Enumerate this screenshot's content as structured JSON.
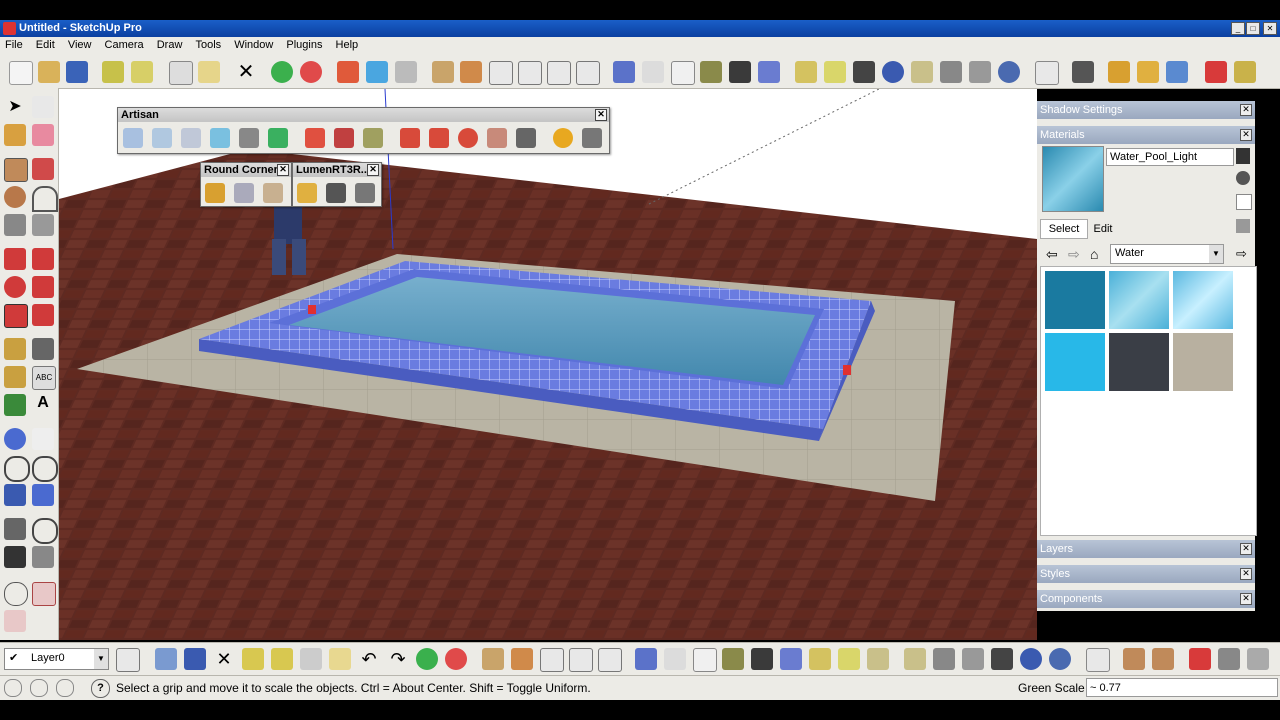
{
  "window": {
    "title": "Untitled - SketchUp Pro"
  },
  "menu": [
    "File",
    "Edit",
    "View",
    "Camera",
    "Draw",
    "Tools",
    "Window",
    "Plugins",
    "Help"
  ],
  "floating_toolbars": {
    "artisan": {
      "title": "Artisan"
    },
    "round_corner": {
      "title": "Round Corner"
    },
    "lumen": {
      "title": "LumenRT3R..."
    }
  },
  "tray": {
    "shadow_settings": "Shadow Settings",
    "materials": {
      "title": "Materials",
      "current_material": "Water_Pool_Light",
      "select_tab": "Select",
      "edit_tab": "Edit",
      "library": "Water"
    },
    "layers": "Layers",
    "styles": "Styles",
    "components": "Components"
  },
  "layer_selector": {
    "value": "Layer0"
  },
  "status": {
    "message": "Select a grip and move it to scale the objects. Ctrl = About Center. Shift = Toggle Uniform.",
    "measure_label": "Green Scale",
    "measure_value": "~ 0.77"
  },
  "colors": {
    "title_bar": "#0b3fa0",
    "chrome": "#ecebe6",
    "tray_header": "#9aa8bf",
    "floor": "#5e2a22",
    "deck": "#b8b3a3",
    "pool_tile": "#5a6fd6",
    "water": "#4a8fb0"
  }
}
